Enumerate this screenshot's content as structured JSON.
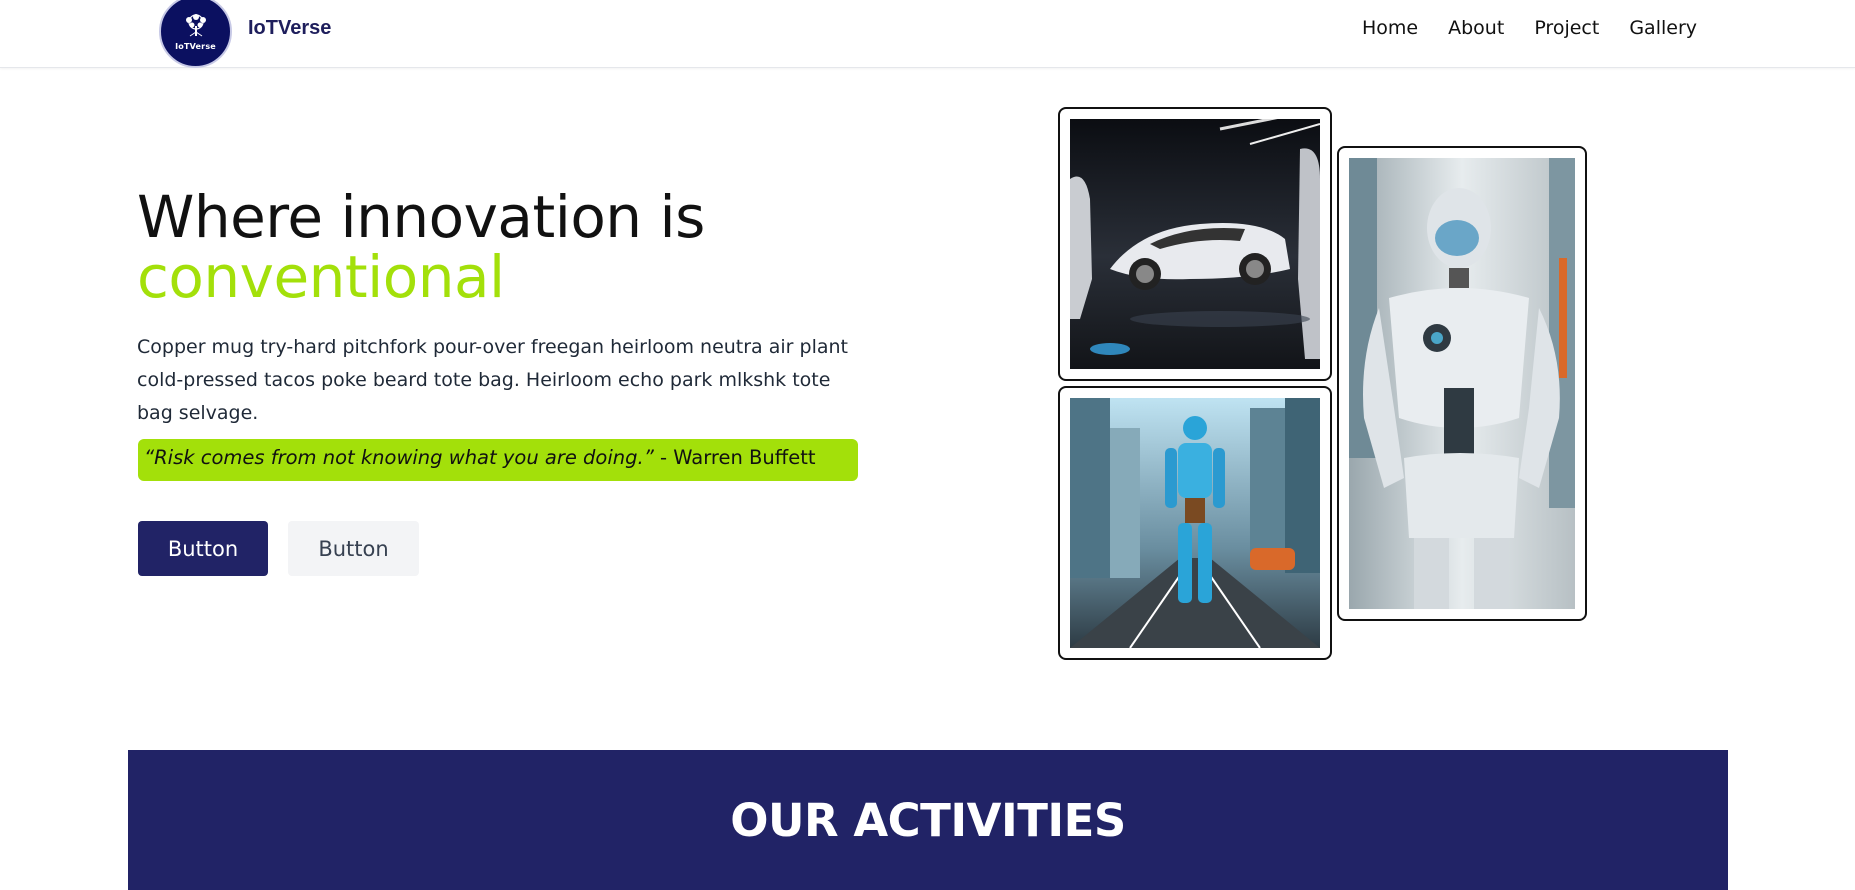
{
  "header": {
    "logo_text": "IoTVerse",
    "brand": "IoTVerse",
    "nav": [
      "Home",
      "About",
      "Project",
      "Gallery"
    ]
  },
  "hero": {
    "title_line1": "Where innovation is",
    "title_accent": "conventional",
    "description": "Copper mug try-hard pitchfork pour-over freegan heirloom neutra air plant cold-pressed tacos poke beard tote bag. Heirloom echo park mlkshk tote bag selvage.",
    "quote": "“Risk comes from not knowing what you are doing.”",
    "quote_author": " - Warren Buffett",
    "primary_button": "Button",
    "secondary_button": "Button"
  },
  "colors": {
    "accent": "#a3e00a",
    "navy": "#212366"
  },
  "activities": {
    "heading": "OUR ACTIVITIES"
  }
}
